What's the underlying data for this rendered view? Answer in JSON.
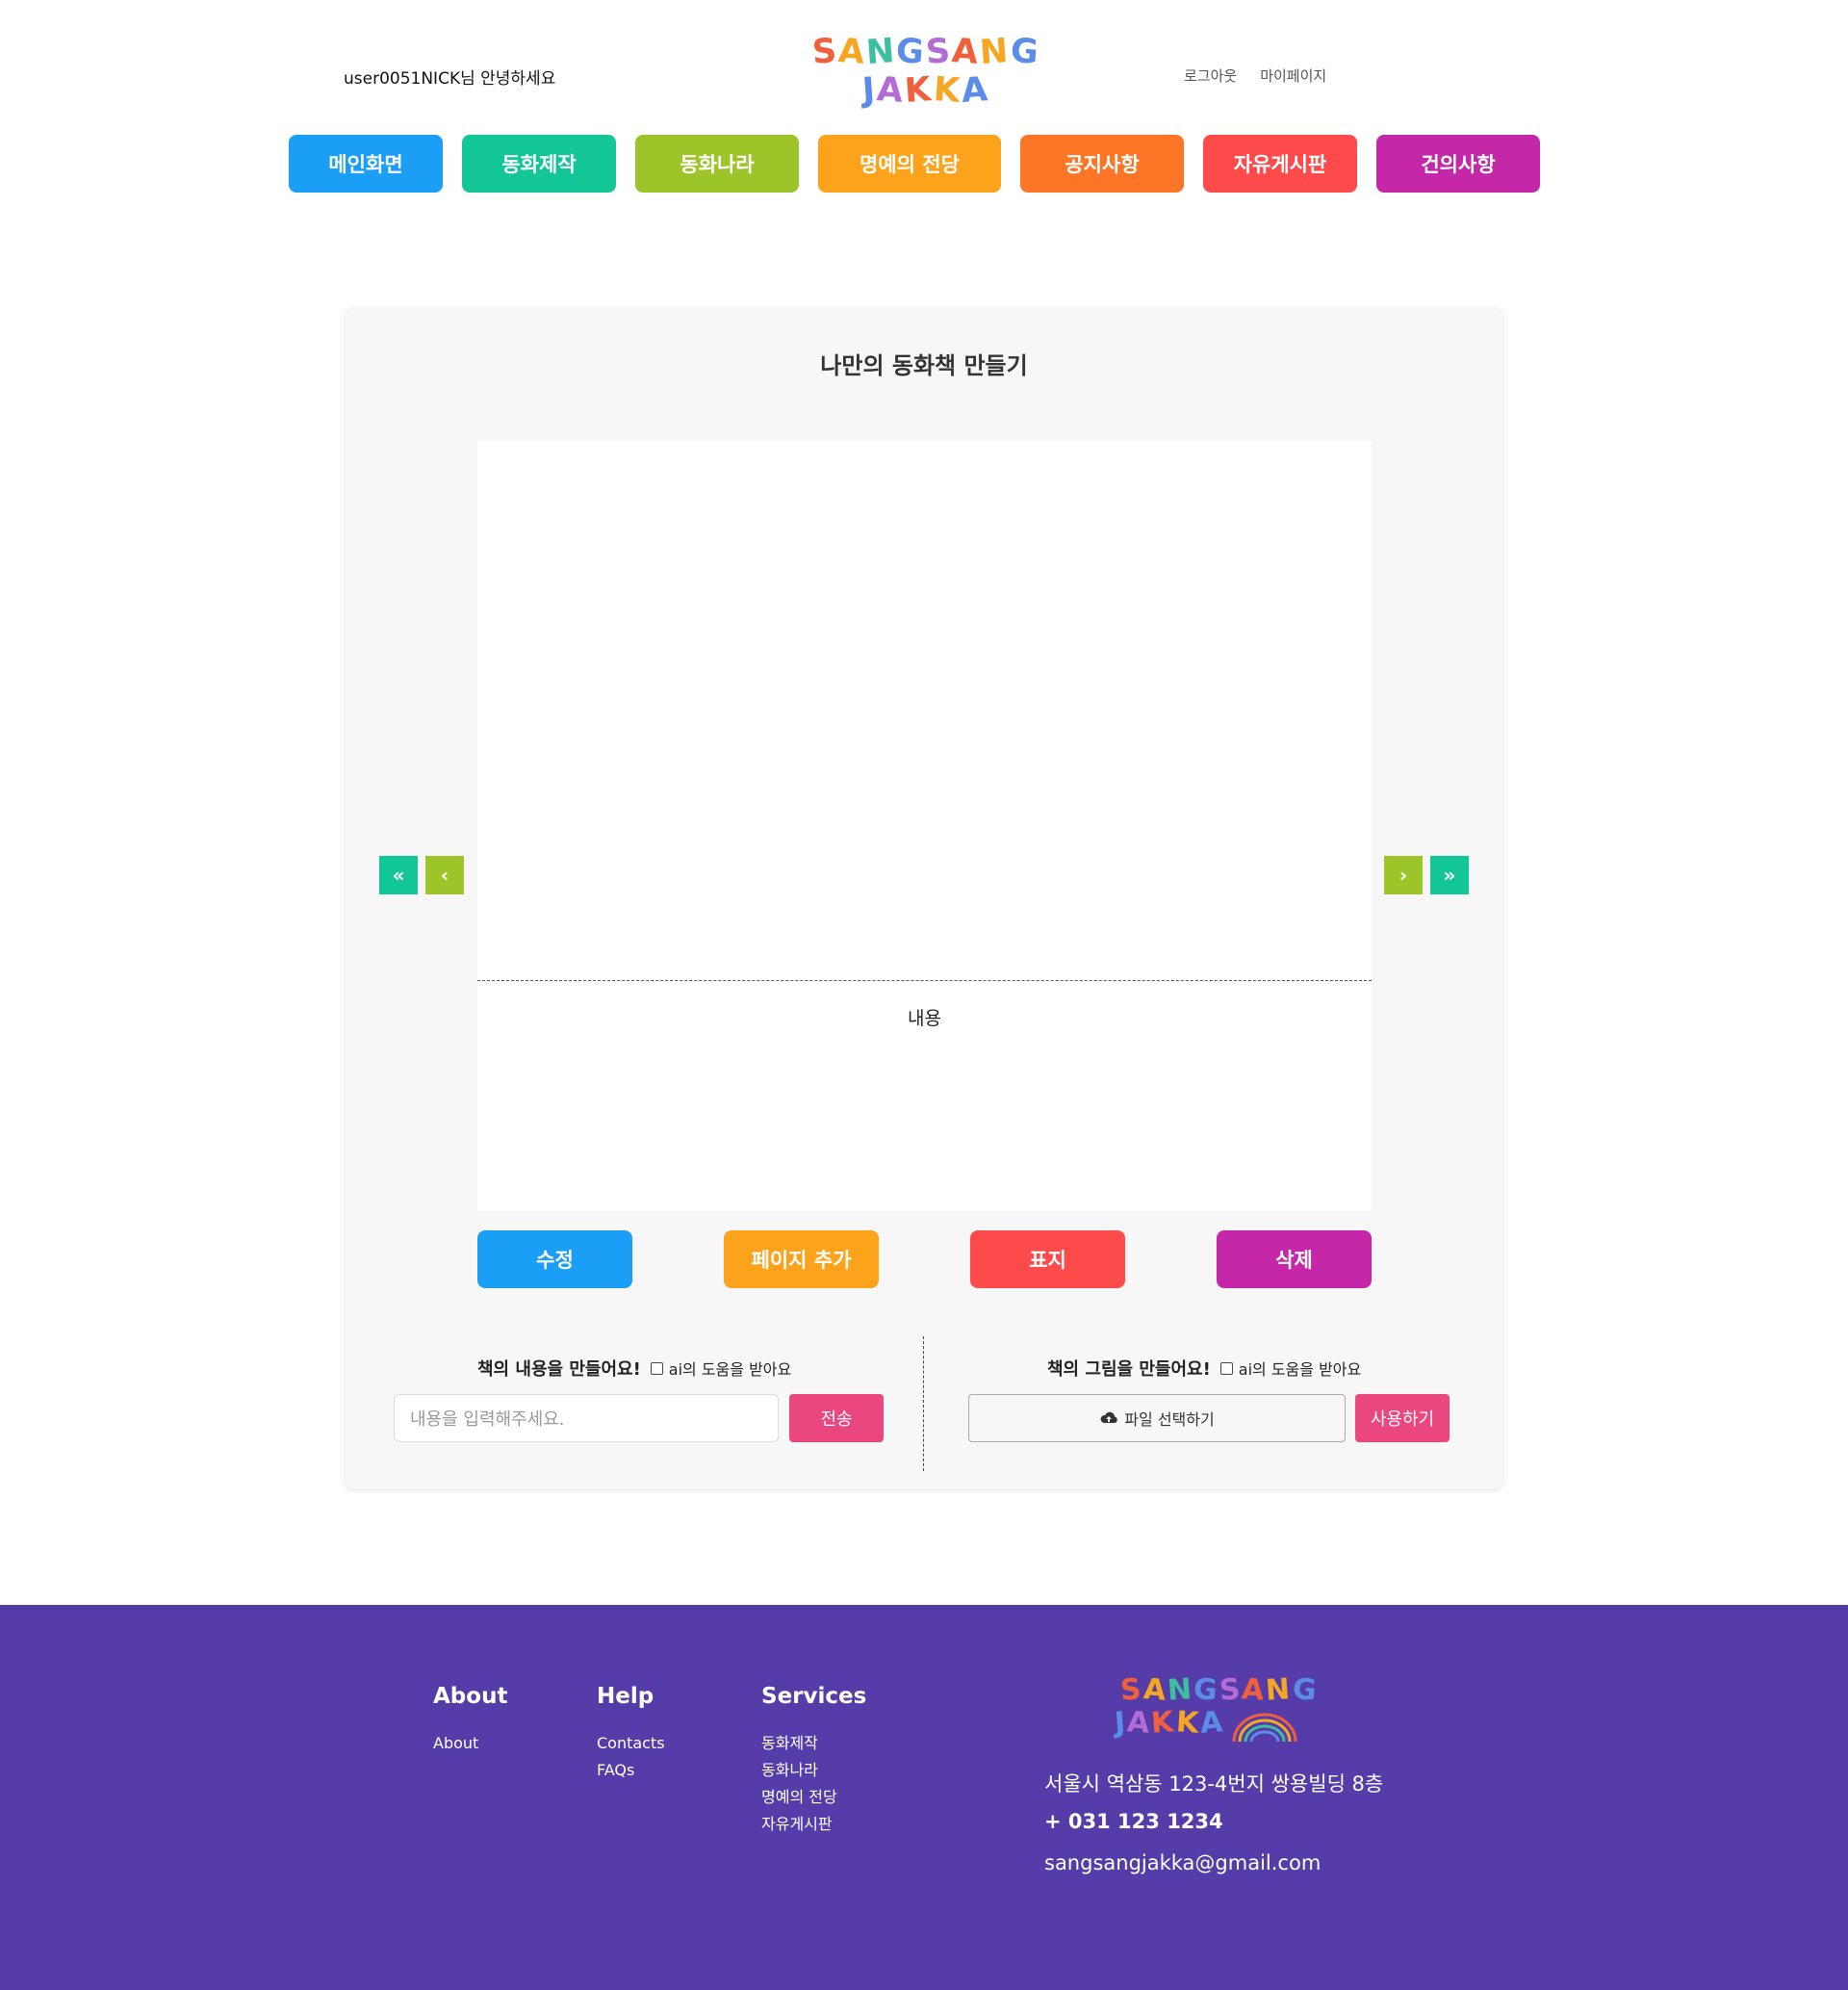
{
  "header": {
    "greeting": "user0051NICK님 안녕하세요",
    "logo_line1": [
      "S",
      "A",
      "N",
      "G",
      "S",
      "A",
      "N",
      "G"
    ],
    "logo_line2": [
      "J",
      "A",
      "K",
      "K",
      "A"
    ],
    "logout": "로그아웃",
    "mypage": "마이페이지"
  },
  "logo_colors": [
    "#f0603c",
    "#f5a623",
    "#3bbf9e",
    "#5b8de8",
    "#b36bd6",
    "#f0603c",
    "#f5a623",
    "#5b8de8"
  ],
  "nav": [
    {
      "label": "메인화면",
      "color": "#1a9ef6"
    },
    {
      "label": "동화제작",
      "color": "#12c795"
    },
    {
      "label": "동화나라",
      "color": "#9dc52a"
    },
    {
      "label": "명예의 전당",
      "color": "#fca21b"
    },
    {
      "label": "공지사항",
      "color": "#fd7627"
    },
    {
      "label": "자유게시판",
      "color": "#fd4b4b"
    },
    {
      "label": "건의사항",
      "color": "#c527a9"
    }
  ],
  "editor": {
    "title": "나만의 동화책 만들기",
    "page_content": "내용",
    "arrow_first": "«",
    "arrow_prev": "‹",
    "arrow_next": "›",
    "arrow_last": "»",
    "actions": [
      {
        "label": "수정",
        "color": "#1a9ef6"
      },
      {
        "label": "페이지 추가",
        "color": "#fca21b"
      },
      {
        "label": "표지",
        "color": "#fd4b4b"
      },
      {
        "label": "삭제",
        "color": "#c527a9"
      }
    ],
    "text_section_label": "책의 내용을 만들어요!",
    "image_section_label": "책의 그림을 만들어요!",
    "ai_help_label": "ai의 도움을 받아요",
    "text_input_placeholder": "내용을 입력해주세요.",
    "send_label": "전송",
    "file_select_label": "파일 선택하기",
    "use_label": "사용하기"
  },
  "footer": {
    "about_title": "About",
    "about_items": [
      "About"
    ],
    "help_title": "Help",
    "help_items": [
      "Contacts",
      "FAQs"
    ],
    "services_title": "Services",
    "services_items": [
      "동화제작",
      "동화나라",
      "명예의 전당",
      "자유게시판"
    ],
    "address": "서울시 역삼동 123-4번지 쌍용빌딩 8층",
    "phone": "+ 031 123 1234",
    "email": "sangsangjakka@gmail.com"
  }
}
